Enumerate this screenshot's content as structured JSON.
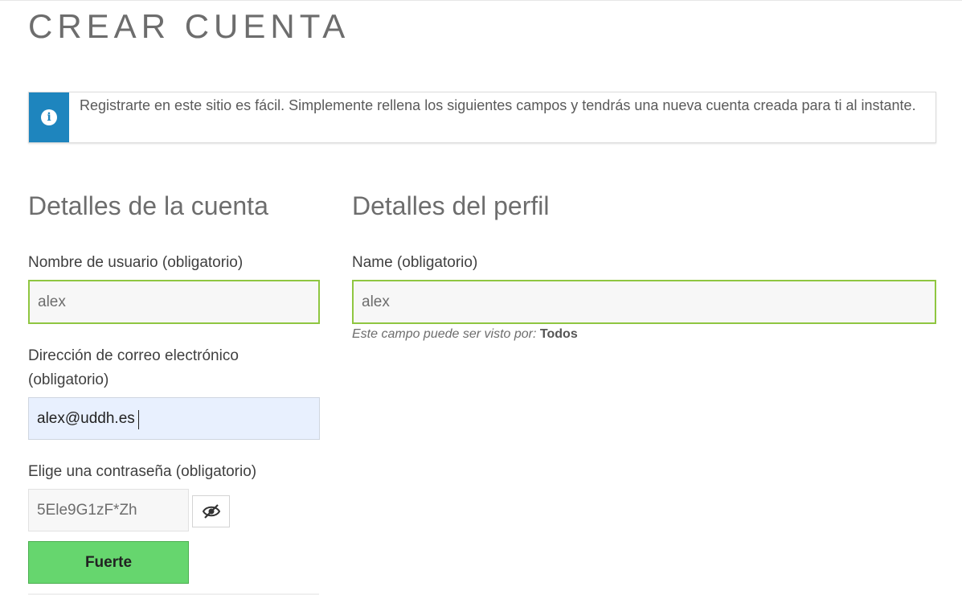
{
  "page": {
    "title": "CREAR CUENTA"
  },
  "notice": {
    "icon": "info-icon",
    "icon_glyph": "i",
    "text": "Registrarte en este sitio es fácil. Simplemente rellena los siguientes campos y tendrás una nueva cuenta creada para ti al instante.",
    "accent_color": "#1e85be"
  },
  "account": {
    "heading": "Detalles de la cuenta",
    "username": {
      "label": "Nombre de usuario (obligatorio)",
      "value": "alex"
    },
    "email": {
      "label": "Dirección de correo electrónico (obligatorio)",
      "value": "alex@uddh.es"
    },
    "password": {
      "label": "Elige una contraseña (obligatorio)",
      "value": "5Ele9G1zF*Zh",
      "toggle_icon": "eye-slash-icon"
    },
    "strength": {
      "label": "Fuerte",
      "color": "#66d66e"
    }
  },
  "profile": {
    "heading": "Detalles del perfil",
    "name": {
      "label": "Name (obligatorio)",
      "value": "alex"
    },
    "visibility_prefix": "Este campo puede ser visto por:",
    "visibility_value": "Todos"
  },
  "colors": {
    "valid_border": "#8fc641",
    "autofill_bg": "#e8f0fe"
  }
}
